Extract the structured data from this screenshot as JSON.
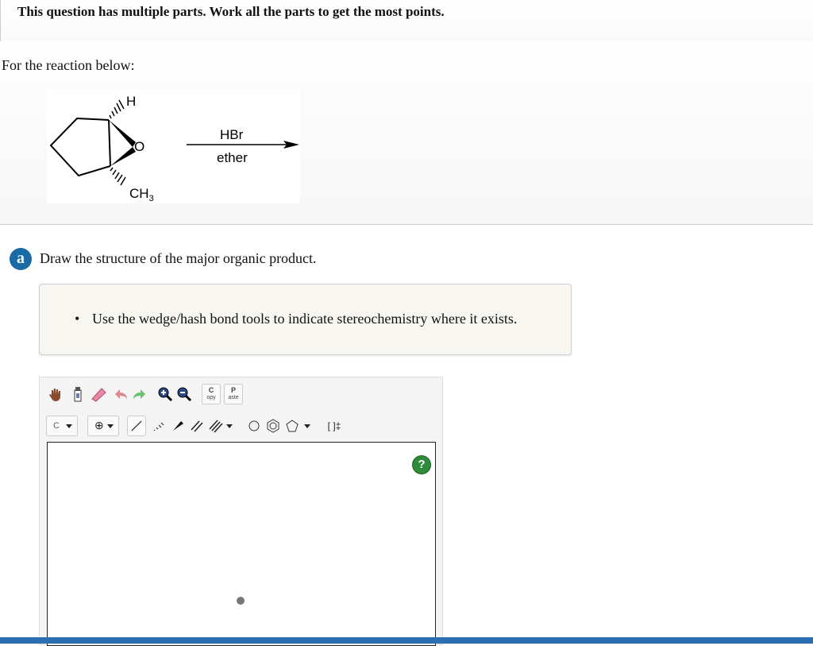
{
  "banner": {
    "text": "This question has multiple parts. Work all the parts to get the most points."
  },
  "question": {
    "prompt": "For the reaction below:",
    "reaction": {
      "reagent_top": "HBr",
      "reagent_bottom": "ether",
      "atom_h": "H",
      "atom_o": "O",
      "methyl": "CH",
      "methyl_sub": "3"
    }
  },
  "part_a": {
    "badge": "a",
    "instruction": "Draw the structure of the major organic product.",
    "hint": "Use the wedge/hash bond tools to indicate stereochemistry where it exists."
  },
  "editor": {
    "toolbar1": [
      "hand-icon",
      "erase-stick-icon",
      "eraser-icon",
      "undo-icon",
      "redo-icon",
      "zoom-in-icon",
      "zoom-out-icon"
    ],
    "copy_label_top": "C",
    "copy_label_bottom": "opy",
    "paste_label_top": "P",
    "paste_label_bottom": "aste",
    "atom_dropdown": "C",
    "charge_symbol": "⊕",
    "bracket_label": "[ ]‡",
    "help_label": "?"
  },
  "colors": {
    "accent": "#1a6aa6",
    "help": "#2e8b3a",
    "bottom_bar": "#2b6fb1"
  }
}
